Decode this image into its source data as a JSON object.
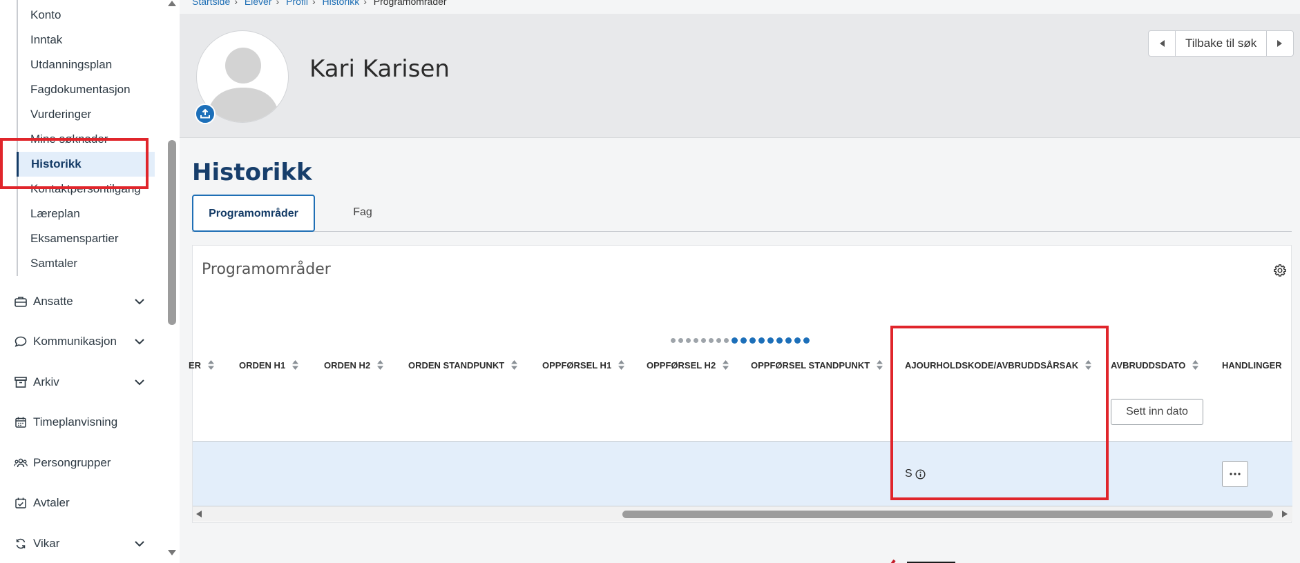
{
  "breadcrumb": [
    "Startside",
    "Elever",
    "Profil",
    "Historikk",
    "Programområder"
  ],
  "sidebar": {
    "sub_items": [
      {
        "label": "Konto"
      },
      {
        "label": "Inntak"
      },
      {
        "label": "Utdanningsplan"
      },
      {
        "label": "Fagdokumentasjon"
      },
      {
        "label": "Vurderinger"
      },
      {
        "label": "Mine søknader"
      },
      {
        "label": "Historikk"
      },
      {
        "label": "Kontaktpersontilgang"
      },
      {
        "label": "Læreplan"
      },
      {
        "label": "Eksamenspartier"
      },
      {
        "label": "Samtaler"
      }
    ],
    "active_sub_item": "Historikk",
    "nav_items": [
      {
        "label": "Ansatte",
        "icon": "briefcase-icon",
        "expandable": true
      },
      {
        "label": "Kommunikasjon",
        "icon": "chat-bubble-icon",
        "expandable": true
      },
      {
        "label": "Arkiv",
        "icon": "archive-box-icon",
        "expandable": true
      },
      {
        "label": "Timeplanvisning",
        "icon": "calendar-icon",
        "expandable": false
      },
      {
        "label": "Persongrupper",
        "icon": "people-group-icon",
        "expandable": false
      },
      {
        "label": "Avtaler",
        "icon": "calendar-check-icon",
        "expandable": false
      },
      {
        "label": "Vikar",
        "icon": "swap-arrows-icon",
        "expandable": true
      }
    ]
  },
  "profile": {
    "name": "Kari Karisen",
    "back_label": "Tilbake til søk"
  },
  "page": {
    "title": "Historikk",
    "tabs": [
      {
        "label": "Programområder",
        "active": true
      },
      {
        "label": "Fag",
        "active": false
      }
    ]
  },
  "card": {
    "title": "Programområder",
    "pagination_dots": {
      "total": 17,
      "active_from": 8
    },
    "columns": [
      "ER",
      "ORDEN H1",
      "ORDEN H2",
      "ORDEN STANDPUNKT",
      "OPPFØRSEL H1",
      "OPPFØRSEL H2",
      "OPPFØRSEL STANDPUNKT",
      "AJOURHOLDSKODE/AVBRUDDSÅRSAK",
      "AVBRUDDSDATO",
      "HANDLINGER"
    ],
    "date_button_label": "Sett inn dato",
    "rows": [
      {
        "ajourholdskode": "S"
      }
    ]
  },
  "colors": {
    "accent": "#1f6fb5",
    "highlight": "#e0252b",
    "row_selected": "#e3eefa"
  }
}
